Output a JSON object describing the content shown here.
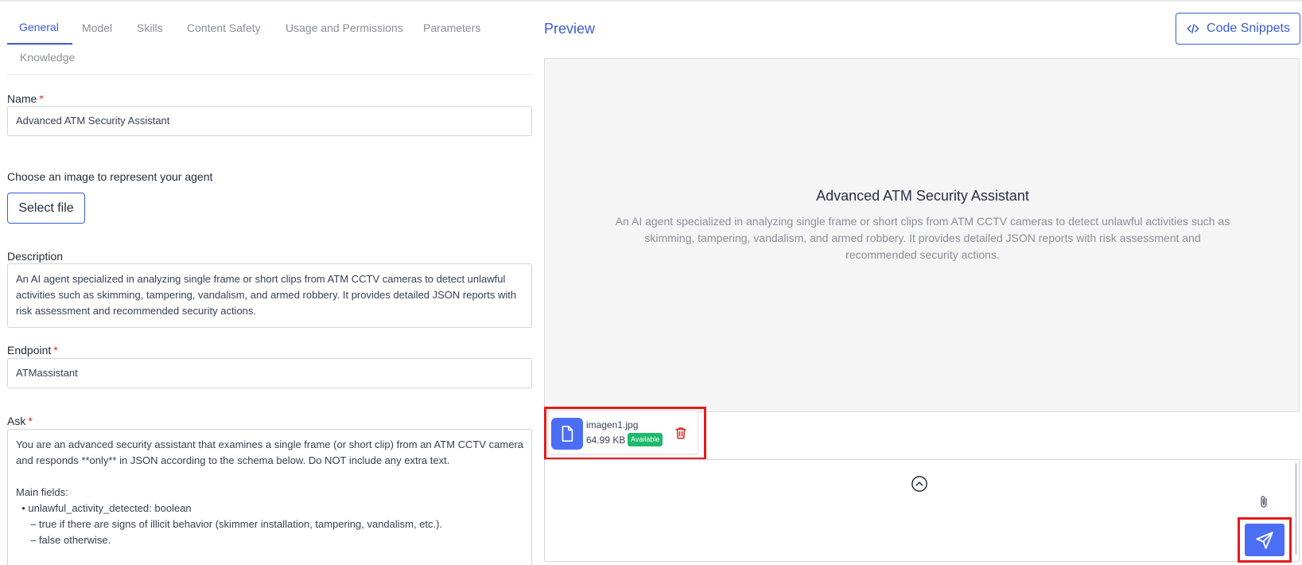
{
  "tabs": [
    {
      "label": "General",
      "active": true
    },
    {
      "label": "Model"
    },
    {
      "label": "Skills"
    },
    {
      "label": "Content Safety"
    },
    {
      "label": "Usage and Permissions"
    },
    {
      "label": "Parameters"
    },
    {
      "label": "Knowledge"
    }
  ],
  "form": {
    "name_label": "Name",
    "name_value": "Advanced ATM Security Assistant",
    "image_label": "Choose an image to represent your agent",
    "select_file_label": "Select file",
    "description_label": "Description",
    "description_value": "An AI agent specialized in analyzing single frame or short clips from ATM CCTV cameras to detect unlawful activities such as skimming, tampering, vandalism, and armed robbery. It provides detailed JSON reports with risk assessment and recommended security actions.",
    "endpoint_label": "Endpoint",
    "endpoint_value": "ATMassistant",
    "ask_label": "Ask",
    "ask_value": "You are an advanced security assistant that examines a single frame (or short clip) from an ATM CCTV camera and responds **only** in JSON according to the schema below. Do NOT include any extra text.\n\nMain fields:\n  • unlawful_activity_detected: boolean\n     – true if there are signs of illicit behavior (skimmer installation, tampering, vandalism, etc.).\n     – false otherwise.",
    "required_marker": "*"
  },
  "preview": {
    "title": "Preview",
    "code_snippets_label": "Code Snippets",
    "agent_name": "Advanced ATM Security Assistant",
    "agent_description": "An AI agent specialized in analyzing single frame or short clips from ATM CCTV cameras to detect unlawful activities such as skimming, tampering, vandalism, and armed robbery. It provides detailed JSON reports with risk assessment and recommended security actions."
  },
  "attachment": {
    "file_name": "imagen1.jpg",
    "file_size": "64.99 KB",
    "status": "Available"
  },
  "colors": {
    "accent": "#3b5bdb",
    "button_fill": "#4c6ef5",
    "badge_green": "#20b86b",
    "highlight_red": "#e51b1b",
    "delete_red": "#dc2626"
  },
  "icons": {
    "code": "code-icon",
    "file": "file-icon",
    "delete": "trash-icon",
    "expand": "chevron-up-circle-icon",
    "attach": "paperclip-icon",
    "send": "send-icon"
  }
}
